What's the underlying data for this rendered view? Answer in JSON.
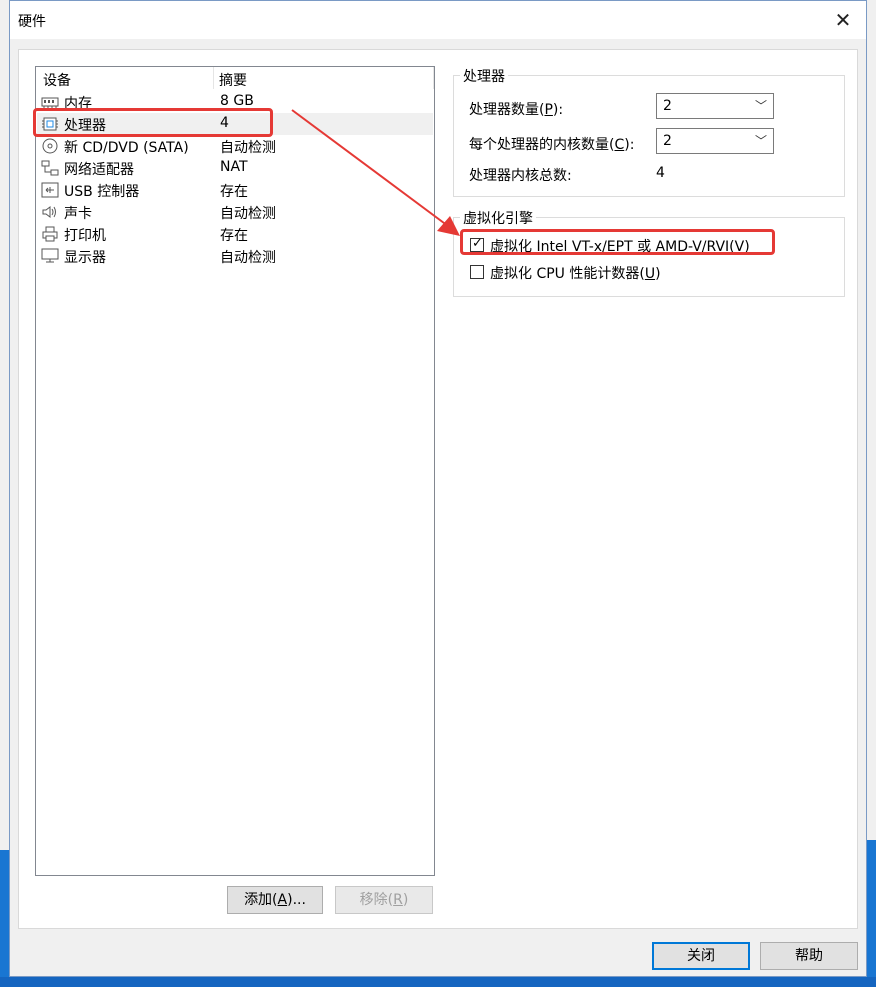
{
  "window": {
    "title": "硬件"
  },
  "list": {
    "header_device": "设备",
    "header_summary": "摘要",
    "rows": [
      {
        "name": "内存",
        "summary": "8 GB",
        "icon": "memory-icon"
      },
      {
        "name": "处理器",
        "summary": "4",
        "icon": "processor-icon"
      },
      {
        "name": "新 CD/DVD (SATA)",
        "summary": "自动检测",
        "icon": "cd-dvd-icon"
      },
      {
        "name": "网络适配器",
        "summary": "NAT",
        "icon": "network-adapter-icon"
      },
      {
        "name": "USB 控制器",
        "summary": "存在",
        "icon": "usb-icon"
      },
      {
        "name": "声卡",
        "summary": "自动检测",
        "icon": "speaker-icon"
      },
      {
        "name": "打印机",
        "summary": "存在",
        "icon": "printer-icon"
      },
      {
        "name": "显示器",
        "summary": "自动检测",
        "icon": "monitor-icon"
      }
    ],
    "selected_index": 1
  },
  "buttons": {
    "add_pre": "添加(",
    "add_key": "A",
    "add_post": ")...",
    "remove_pre": "移除(",
    "remove_key": "R",
    "remove_post": ")",
    "close": "关闭",
    "help": "帮助"
  },
  "processor_group": {
    "title": "处理器",
    "num_processors_pre": "处理器数量(",
    "num_processors_key": "P",
    "num_processors_post": "):",
    "num_processors_value": "2",
    "cores_pre": "每个处理器的内核数量(",
    "cores_key": "C",
    "cores_post": "):",
    "cores_value": "2",
    "total_label": "处理器内核总数:",
    "total_value": "4"
  },
  "virt_group": {
    "title": "虚拟化引擎",
    "vtx_pre": "虚拟化 Intel VT-x/EPT 或 AMD-V/RVI(",
    "vtx_key": "V",
    "vtx_post": ")",
    "vtx_checked": true,
    "cpu_counter_pre": "虚拟化 CPU 性能计数器(",
    "cpu_counter_key": "U",
    "cpu_counter_post": ")",
    "cpu_counter_checked": false
  },
  "colors": {
    "annotation": "#e53935",
    "focus": "#0078d7"
  }
}
